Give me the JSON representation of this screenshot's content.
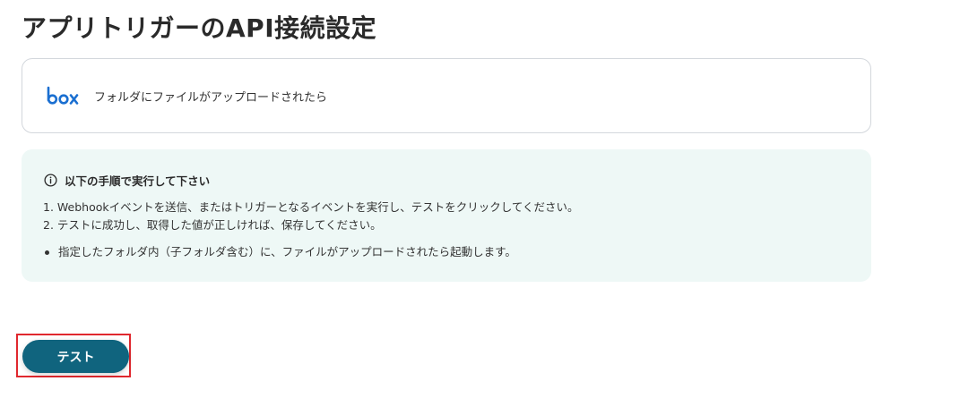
{
  "page": {
    "title": "アプリトリガーのAPI接続設定"
  },
  "trigger": {
    "logo": "box",
    "logo_color": "#1a6fd1",
    "label": "フォルダにファイルがアップロードされたら"
  },
  "instructions": {
    "icon": "info-icon",
    "heading": "以下の手順で実行して下さい",
    "steps": [
      "1. Webhookイベントを送信、またはトリガーとなるイベントを実行し、テストをクリックしてください。",
      "2. テストに成功し、取得した値が正しければ、保存してください。"
    ],
    "notes": [
      "指定したフォルダ内（子フォルダ含む）に、ファイルがアップロードされたら起動します。"
    ],
    "background": "#eef8f6"
  },
  "actions": {
    "test_label": "テスト",
    "button_color": "#10647e",
    "highlight_color": "#e0282e"
  }
}
